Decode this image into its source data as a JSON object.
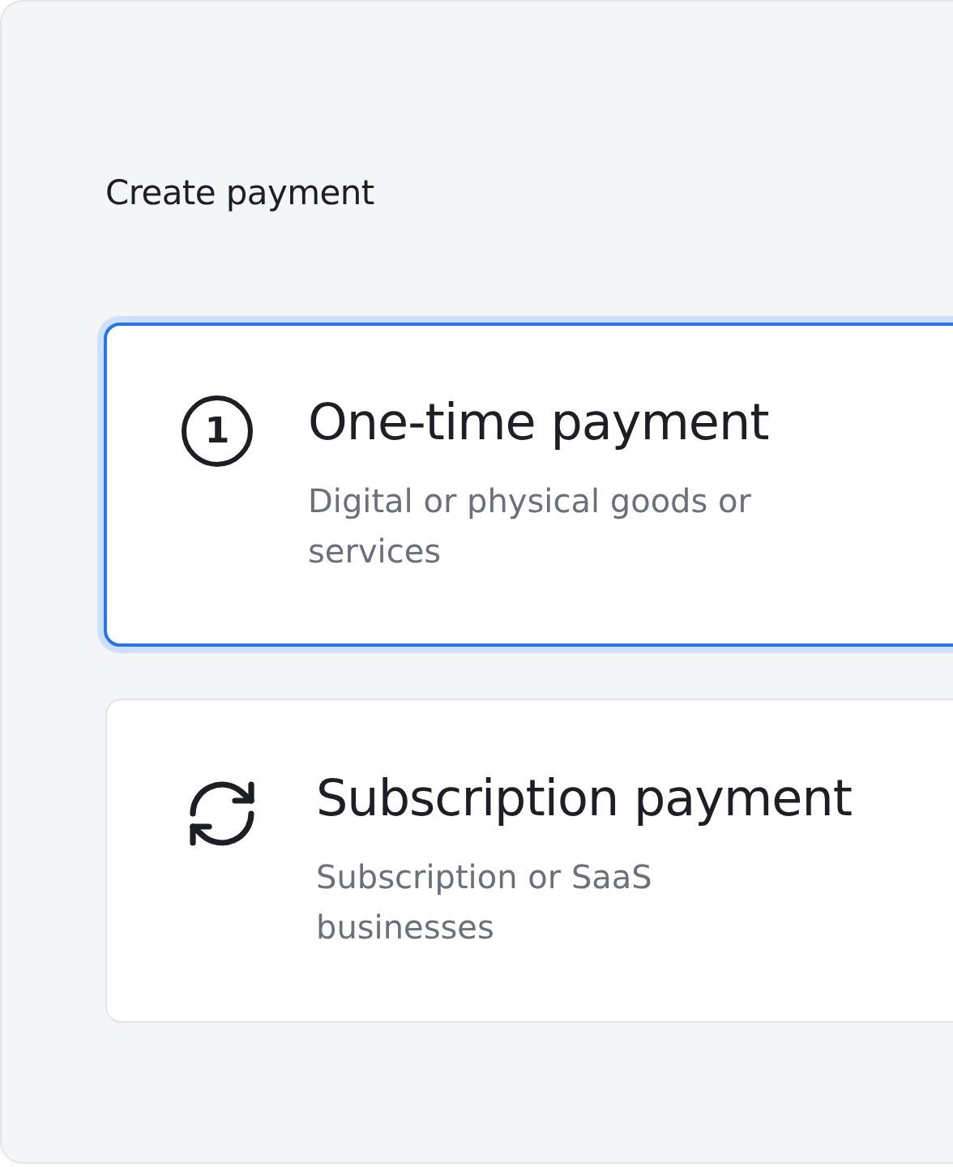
{
  "title": "Create payment",
  "options": [
    {
      "kind": "number",
      "badge": "1",
      "title": "One-time payment",
      "description": "Digital or physical goods or services",
      "selected": true
    },
    {
      "kind": "recurring",
      "title": "Subscription payment",
      "description": "Subscription or SaaS businesses",
      "selected": false
    }
  ]
}
